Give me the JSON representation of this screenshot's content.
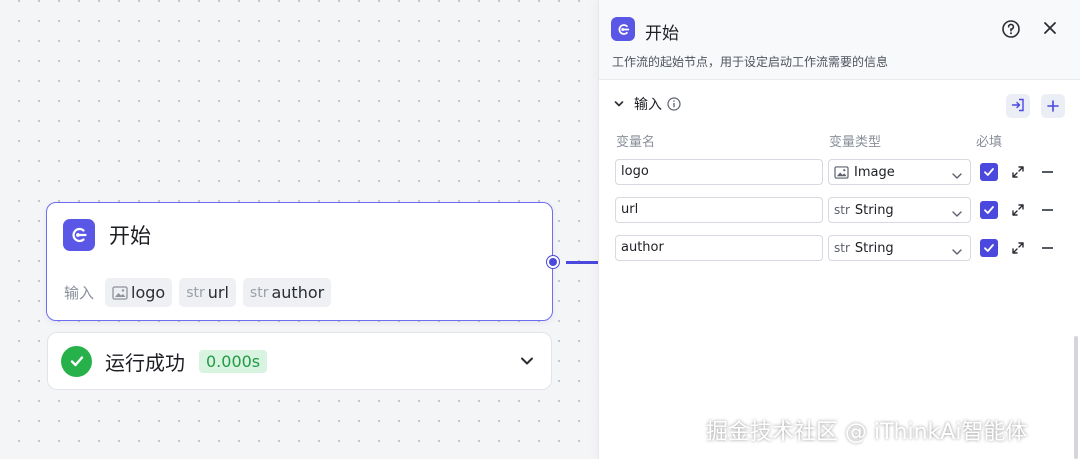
{
  "node": {
    "title": "开始",
    "inputs_label": "输入",
    "chips": [
      {
        "type_icon": "image-icon",
        "label": "logo"
      },
      {
        "type_icon": "str",
        "label": "url"
      },
      {
        "type_icon": "str",
        "label": "author"
      }
    ]
  },
  "run_status": {
    "label": "运行成功",
    "time": "0.000s"
  },
  "panel": {
    "title": "开始",
    "description": "工作流的起始节点，用于设定启动工作流需要的信息",
    "section_title": "输入",
    "columns": {
      "name": "变量名",
      "type": "变量类型",
      "required": "必填"
    },
    "variables": [
      {
        "name": "logo",
        "type_icon": "image-icon",
        "type": "Image",
        "required": true
      },
      {
        "name": "url",
        "type_icon": "str",
        "type": "String",
        "required": true
      },
      {
        "name": "author",
        "type_icon": "str",
        "type": "String",
        "required": true
      }
    ]
  },
  "colors": {
    "accent": "#5a57e6",
    "success": "#26b14a",
    "success_bg": "#d8f3df"
  },
  "watermark": "掘金技术社区 @ iThinkAi智能体"
}
